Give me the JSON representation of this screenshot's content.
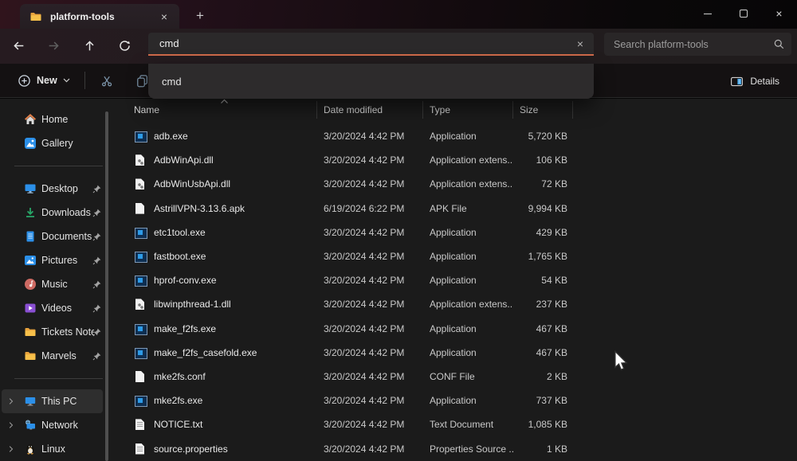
{
  "titlebar": {
    "tab_title": "platform-tools"
  },
  "nav": {
    "address_value": "cmd",
    "suggestion": "cmd",
    "search_placeholder": "Search platform-tools"
  },
  "toolbar": {
    "new_label": "New",
    "details_label": "Details"
  },
  "colors": {
    "accent_underline": "#cf6a4a",
    "selection_bg": "#2e2e2e",
    "exe_icon_blue": "#2e9be6",
    "details_icon_blue": "#3fa3e8"
  },
  "sidebar": {
    "items": [
      {
        "label": "Home",
        "icon": "home"
      },
      {
        "label": "Gallery",
        "icon": "gallery"
      },
      {
        "type": "separator"
      },
      {
        "label": "Desktop",
        "icon": "desktop",
        "pinned": true
      },
      {
        "label": "Downloads",
        "icon": "downloads",
        "pinned": true
      },
      {
        "label": "Documents",
        "icon": "documents",
        "pinned": true
      },
      {
        "label": "Pictures",
        "icon": "pictures",
        "pinned": true
      },
      {
        "label": "Music",
        "icon": "music",
        "pinned": true
      },
      {
        "label": "Videos",
        "icon": "videos",
        "pinned": true
      },
      {
        "label": "Tickets Notes",
        "icon": "folder",
        "pinned": true
      },
      {
        "label": "Marvels",
        "icon": "folder",
        "pinned": true
      },
      {
        "type": "separator"
      },
      {
        "label": "This PC",
        "icon": "pc",
        "chevron": true,
        "selected": true
      },
      {
        "label": "Network",
        "icon": "network",
        "chevron": true
      },
      {
        "label": "Linux",
        "icon": "linux",
        "chevron": true
      }
    ]
  },
  "list": {
    "columns": [
      "Name",
      "Date modified",
      "Type",
      "Size"
    ],
    "files": [
      {
        "name": "adb.exe",
        "date": "3/20/2024 4:42 PM",
        "type": "Application",
        "size": "5,720 KB",
        "icon": "exe"
      },
      {
        "name": "AdbWinApi.dll",
        "date": "3/20/2024 4:42 PM",
        "type": "Application extens...",
        "size": "106 KB",
        "icon": "dll"
      },
      {
        "name": "AdbWinUsbApi.dll",
        "date": "3/20/2024 4:42 PM",
        "type": "Application extens...",
        "size": "72 KB",
        "icon": "dll"
      },
      {
        "name": "AstrillVPN-3.13.6.apk",
        "date": "6/19/2024 6:22 PM",
        "type": "APK File",
        "size": "9,994 KB",
        "icon": "file"
      },
      {
        "name": "etc1tool.exe",
        "date": "3/20/2024 4:42 PM",
        "type": "Application",
        "size": "429 KB",
        "icon": "exe"
      },
      {
        "name": "fastboot.exe",
        "date": "3/20/2024 4:42 PM",
        "type": "Application",
        "size": "1,765 KB",
        "icon": "exe"
      },
      {
        "name": "hprof-conv.exe",
        "date": "3/20/2024 4:42 PM",
        "type": "Application",
        "size": "54 KB",
        "icon": "exe"
      },
      {
        "name": "libwinpthread-1.dll",
        "date": "3/20/2024 4:42 PM",
        "type": "Application extens...",
        "size": "237 KB",
        "icon": "dll"
      },
      {
        "name": "make_f2fs.exe",
        "date": "3/20/2024 4:42 PM",
        "type": "Application",
        "size": "467 KB",
        "icon": "exe"
      },
      {
        "name": "make_f2fs_casefold.exe",
        "date": "3/20/2024 4:42 PM",
        "type": "Application",
        "size": "467 KB",
        "icon": "exe"
      },
      {
        "name": "mke2fs.conf",
        "date": "3/20/2024 4:42 PM",
        "type": "CONF File",
        "size": "2 KB",
        "icon": "file"
      },
      {
        "name": "mke2fs.exe",
        "date": "3/20/2024 4:42 PM",
        "type": "Application",
        "size": "737 KB",
        "icon": "exe"
      },
      {
        "name": "NOTICE.txt",
        "date": "3/20/2024 4:42 PM",
        "type": "Text Document",
        "size": "1,085 KB",
        "icon": "text"
      },
      {
        "name": "source.properties",
        "date": "3/20/2024 4:42 PM",
        "type": "Properties Source ...",
        "size": "1 KB",
        "icon": "text"
      }
    ]
  }
}
